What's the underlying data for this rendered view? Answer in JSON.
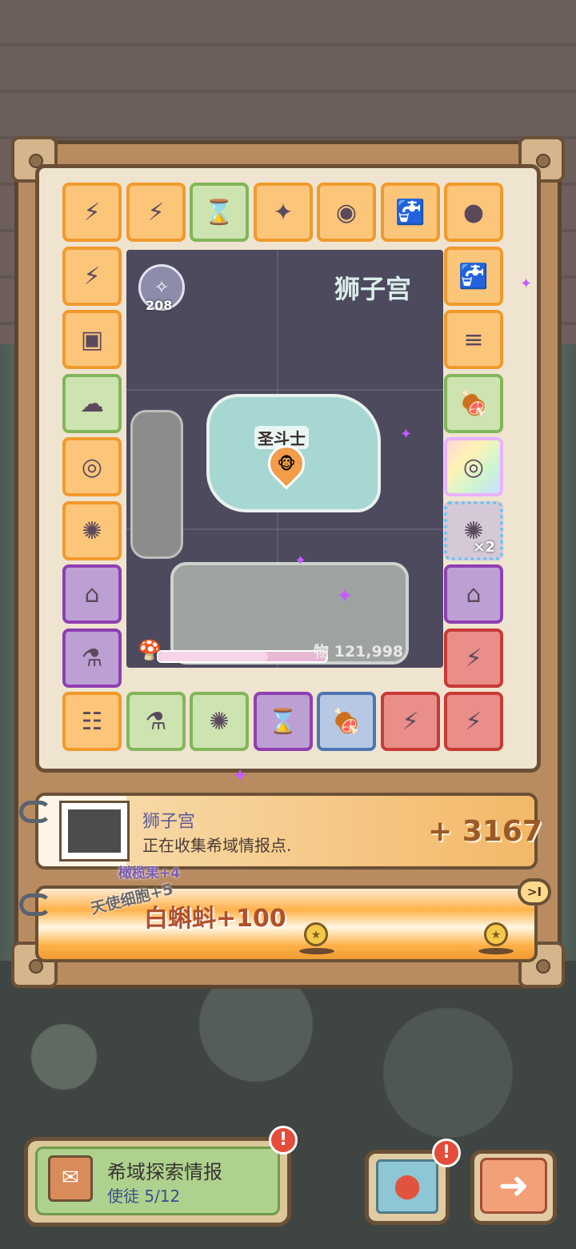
{
  "board": {
    "zodiac_title": "狮子宫",
    "resource_count": "208",
    "unit_label": "圣斗士",
    "unit_icon": "monkey-icon",
    "resource_total": "物 121,998",
    "progress_fraction": 0.65
  },
  "cells": {
    "top": [
      {
        "color": "orange",
        "icon": "⚡",
        "icon_name": "energy-bottle-icon"
      },
      {
        "color": "orange",
        "icon": "⚡",
        "icon_name": "energy-bottle-icon"
      },
      {
        "color": "green",
        "icon": "⌛",
        "icon_name": "hourglass-icon"
      },
      {
        "color": "orange",
        "icon": "✦",
        "icon_name": "bundle-icon"
      },
      {
        "color": "orange",
        "icon": "◉",
        "icon_name": "ball-icon"
      },
      {
        "color": "orange",
        "icon": "🚰",
        "icon_name": "faucet-icon"
      },
      {
        "color": "orange",
        "icon": "●",
        "icon_name": "ball-icon"
      }
    ],
    "left": [
      {
        "color": "orange",
        "icon": "⚡",
        "icon_name": "energy-bottle-icon"
      },
      {
        "color": "orange",
        "icon": "▣",
        "icon_name": "box-icon"
      },
      {
        "color": "green",
        "icon": "☁",
        "icon_name": "cloud-icon"
      },
      {
        "color": "orange",
        "icon": "◎",
        "icon_name": "rune-card-icon"
      },
      {
        "color": "orange",
        "icon": "✺",
        "icon_name": "gear-icon"
      },
      {
        "color": "purple",
        "icon": "⌂",
        "icon_name": "house-icon"
      },
      {
        "color": "purple",
        "icon": "⚗",
        "icon_name": "potion-icon"
      }
    ],
    "right": [
      {
        "color": "orange",
        "icon": "🚰",
        "icon_name": "faucet-icon"
      },
      {
        "color": "orange",
        "icon": "≡",
        "icon_name": "ruins-icon"
      },
      {
        "color": "green",
        "icon": "🍖",
        "icon_name": "meat-icon"
      },
      {
        "color": "rainbow",
        "icon": "◎",
        "icon_name": "rune-card-icon"
      },
      {
        "color": "dotted",
        "icon": "✺",
        "icon_name": "gear-icon",
        "multiplier": "×2"
      },
      {
        "color": "purple",
        "icon": "⌂",
        "icon_name": "house-icon"
      },
      {
        "color": "red",
        "icon": "⚡",
        "icon_name": "energy-bottle-icon"
      }
    ],
    "bottom": [
      {
        "color": "orange",
        "icon": "☷",
        "icon_name": "scroll-icon"
      },
      {
        "color": "green",
        "icon": "⚗",
        "icon_name": "potion-icon"
      },
      {
        "color": "green",
        "icon": "✺",
        "icon_name": "gear-icon"
      },
      {
        "color": "purple",
        "icon": "⌛",
        "icon_name": "hourglass-icon"
      },
      {
        "color": "blue",
        "icon": "🍖",
        "icon_name": "meat-icon"
      },
      {
        "color": "red",
        "icon": "⚡",
        "icon_name": "energy-bottle-icon"
      },
      {
        "color": "red",
        "icon": "⚡",
        "icon_name": "energy-bottle-icon"
      }
    ]
  },
  "info_card": {
    "title": "狮子宫",
    "subtitle": "正在收集希域情报点.",
    "value": "+ 3167"
  },
  "floating": {
    "olive": "橄榄果+4",
    "angel": "天使细胞+5",
    "shrimp": "白蝌蚪+100"
  },
  "bonus_bar": {
    "skip_label": ">I",
    "coin_icon": "star-coin-icon"
  },
  "mission": {
    "title": "希域探索情报",
    "subtitle": "使徒 5/12",
    "alert": "!"
  },
  "map": {
    "alert": "!",
    "icon": "map-pin-icon"
  },
  "next": {
    "icon": "arrow-right-icon",
    "glyph": "➜"
  },
  "colors": {
    "accent_orange": "#f19a2c",
    "panel_wood": "#b88c60",
    "alert_red": "#e44c3c",
    "sparkle_purple": "#c65dff"
  }
}
